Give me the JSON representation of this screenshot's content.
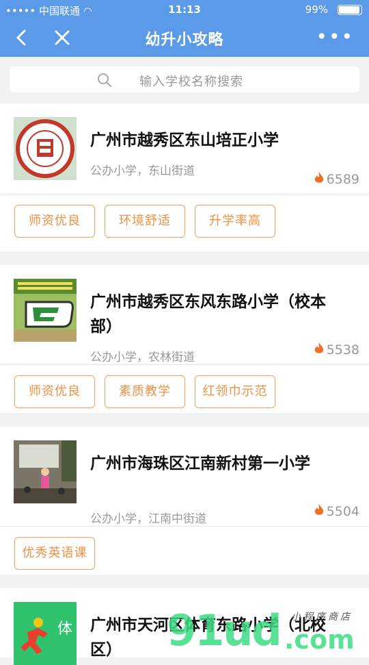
{
  "status_bar": {
    "carrier": "中国联通",
    "time": "11:13",
    "battery": "99%",
    "battery_level": 0.99
  },
  "nav": {
    "title": "幼升小攻略"
  },
  "search": {
    "placeholder": "输入学校名称搜索"
  },
  "schools": [
    {
      "name": "广州市越秀区东山培正小学",
      "desc": "公办小学，东山街道",
      "hot": "6589",
      "tags": [
        "师资优良",
        "环境舒适",
        "升学率高"
      ]
    },
    {
      "name": "广州市越秀区东风东路小学（校本部）",
      "desc": "公办小学，农林街道",
      "hot": "5538",
      "tags": [
        "师资优良",
        "素质教学",
        "红领巾示范"
      ]
    },
    {
      "name": "广州市海珠区江南新村第一小学",
      "desc": "公办小学，江南中街道",
      "hot": "5504",
      "tags": [
        "优秀英语课"
      ]
    },
    {
      "name": "广州市天河区体育东路小学（北校区）"
    }
  ],
  "watermark": {
    "main": "91ud",
    "suffix": ".com",
    "small": "小程序商店"
  },
  "colors": {
    "nav": "#5b9ae8",
    "tag": "#f09040",
    "hot": "#f07028"
  }
}
